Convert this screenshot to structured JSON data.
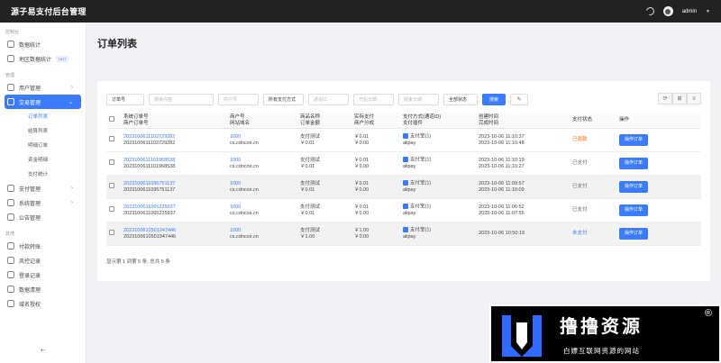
{
  "app": {
    "title": "源子易支付后台管理",
    "user": "admin"
  },
  "sidebar": {
    "sec1": "控制台",
    "dashboard": "数据统计",
    "region": "地区数据统计",
    "hot": "HOT",
    "sec2": "管理",
    "users": "用户管理",
    "trade": "交易管理",
    "subs": [
      "订单列表",
      "结算列表",
      "明细订单",
      "资金明细",
      "支付统计"
    ],
    "pay": "支付管理",
    "system": "系统管理",
    "notice": "公告管理",
    "sec3": "其他",
    "others": [
      "付款转账",
      "风控记录",
      "登录记录",
      "数据清理",
      "域名授权"
    ]
  },
  "page": {
    "title": "订单列表"
  },
  "filters": {
    "type": "订单号",
    "keyword": "搜索内容",
    "merchant": "商户号",
    "paytype": "所有支付方式",
    "channel": "通道ID",
    "start": "开始日期",
    "end": "结束日期",
    "status": "全部状态",
    "search": "搜索"
  },
  "table": {
    "headers": [
      [
        "系统订单号",
        "商户订单号"
      ],
      [
        "商户号",
        "网站域名"
      ],
      [
        "商品名称",
        "订单金额"
      ],
      [
        "实际支付",
        "商户分成"
      ],
      [
        "支付方式(通道ID)",
        "支付插件"
      ],
      [
        "创建时间",
        "完成时间"
      ],
      [
        "支付状态"
      ],
      [
        "操作"
      ]
    ],
    "rows": [
      {
        "sys": "2023100611103729282",
        "mer": "2023100611103729282",
        "uid": "1000",
        "site": "cs.cdncos.cn",
        "name": "支付测试",
        "money": "￥0.01",
        "real": "￥0.01",
        "get": "￥0.00",
        "type": "支付宝(1)",
        "plugin": "alipay",
        "ctime": "2023-10-06 11:10:37",
        "etime": "2023-10-06 11:10:48",
        "status": "已退款",
        "scls": "st-red",
        "op": "操作订单"
      },
      {
        "sys": "2023100611101968538",
        "mer": "2023100611101968538",
        "uid": "1000",
        "site": "cs.cdncos.cn",
        "name": "支付测试",
        "money": "￥0.01",
        "real": "￥0.01",
        "get": "￥0.00",
        "type": "支付宝(1)",
        "plugin": "alipay",
        "ctime": "2023-10-06 11:10:19",
        "etime": "2023-10-06 11:10:27",
        "status": "已支付",
        "scls": "st-gray",
        "op": "操作订单"
      },
      {
        "sys": "2023100611095751137",
        "mer": "2023100611095751137",
        "uid": "1000",
        "site": "cs.cdncos.cn",
        "name": "支付测试",
        "money": "￥0.01",
        "real": "￥0.01",
        "get": "￥0.00",
        "type": "支付宝(1)",
        "plugin": "alipay",
        "ctime": "2023-10-06 11:09:57",
        "etime": "2023-10-06 11:10:09",
        "status": "已支付",
        "scls": "st-gray",
        "op": "操作订单"
      },
      {
        "sys": "2023100611065225937",
        "mer": "2023100611065225937",
        "uid": "1000",
        "site": "cs.cdncos.cn",
        "name": "支付测试",
        "money": "￥0.01",
        "real": "￥0.01",
        "get": "￥0.00",
        "type": "支付宝(1)",
        "plugin": "alipay",
        "ctime": "2023-10-06 11:06:52",
        "etime": "2023-10-06 11:07:56",
        "status": "已支付",
        "scls": "st-gray",
        "op": "操作订单"
      },
      {
        "sys": "2023100610501947446",
        "mer": "2023100610501947446",
        "uid": "1000",
        "site": "cs.cdncos.cn",
        "name": "支付测试",
        "money": "￥1.00",
        "real": "￥1.00",
        "get": "￥0.00",
        "type": "支付宝(1)",
        "plugin": "alipay",
        "ctime": "2023-10-06 10:50:19",
        "etime": "",
        "status": "未支付",
        "scls": "st-blue",
        "op": "操作订单"
      }
    ]
  },
  "pagination": {
    "summary": "显示第 1 到第 5 条, 总共 5 条"
  },
  "watermark": {
    "title": "撸撸资源",
    "sub": "白嫖互联网资源的网站",
    "reg": "®"
  },
  "colors": {
    "accent": "#3b7cff",
    "refund": "#ff6a00"
  }
}
